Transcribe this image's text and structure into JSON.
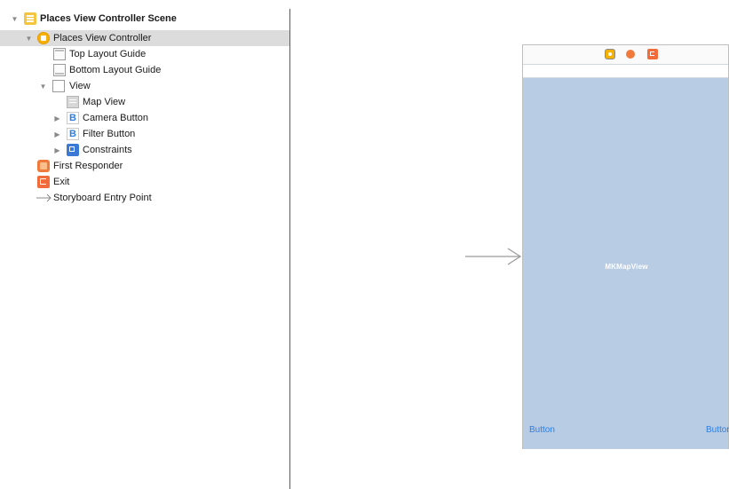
{
  "outline": {
    "scene_title": "Places View Controller Scene",
    "view_controller": "Places View Controller",
    "top_layout_guide": "Top Layout Guide",
    "bottom_layout_guide": "Bottom Layout Guide",
    "view": "View",
    "map_view": "Map View",
    "camera_button": "Camera Button",
    "filter_button": "Filter Button",
    "constraints": "Constraints",
    "first_responder": "First Responder",
    "exit": "Exit",
    "storyboard_entry_point": "Storyboard Entry Point",
    "button_icon_letter": "B"
  },
  "canvas": {
    "map_label": "MKMapView",
    "button_left": "Button",
    "button_right": "Button"
  },
  "colors": {
    "selection": "#dcdcdc",
    "map_fill": "#b8cce4",
    "button_text": "#2f7de1",
    "scene_yellow": "#f5c542",
    "responder_orange": "#f07a3b",
    "constraint_blue": "#3b79d6"
  },
  "icons": {
    "scene": "scene-icon",
    "view_controller": "view-controller-icon",
    "layout_guide": "layout-guide-icon",
    "view": "view-icon",
    "map": "map-view-icon",
    "button": "button-icon",
    "constraints": "constraints-icon",
    "first_responder": "first-responder-icon",
    "exit": "exit-icon",
    "entry_point": "arrow-right-icon"
  }
}
